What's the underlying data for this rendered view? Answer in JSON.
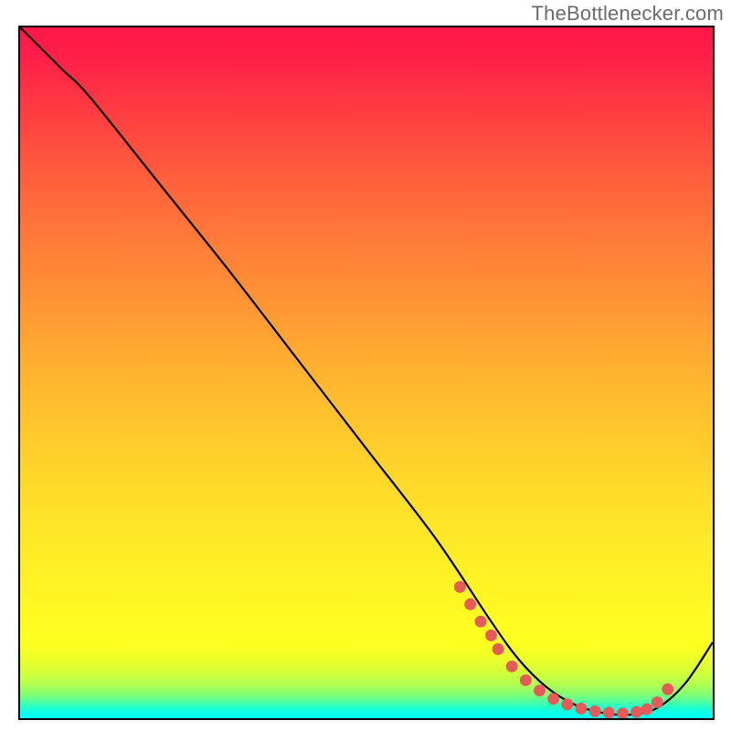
{
  "watermark": "TheBottlenecker.com",
  "chart_data": {
    "type": "line",
    "title": "",
    "xlabel": "",
    "ylabel": "",
    "xlim": [
      0,
      100
    ],
    "ylim": [
      0,
      100
    ],
    "series": [
      {
        "name": "curve",
        "x": [
          0,
          6,
          10,
          20,
          30,
          40,
          50,
          60,
          68,
          72,
          76,
          80,
          84,
          88,
          92,
          96,
          100
        ],
        "y": [
          100,
          94,
          90,
          77.5,
          65,
          52,
          39,
          26,
          14,
          8.5,
          4.5,
          2,
          0.8,
          0.5,
          1.5,
          5,
          11
        ]
      }
    ],
    "markers": {
      "name": "scatter-points",
      "color": "#e65a5a",
      "x": [
        63.5,
        65,
        66.5,
        68,
        69,
        71,
        73,
        75,
        77,
        79,
        81,
        83,
        85,
        87,
        89,
        90.5,
        92,
        93.5
      ],
      "y": [
        19,
        16.5,
        14,
        12,
        10,
        7.5,
        5.5,
        4,
        2.8,
        2,
        1.4,
        1.0,
        0.8,
        0.7,
        0.9,
        1.3,
        2.3,
        4.2
      ]
    },
    "gradient_stops": [
      {
        "pos": 0,
        "color": "#ff1748"
      },
      {
        "pos": 50,
        "color": "#ffb22f"
      },
      {
        "pos": 86,
        "color": "#fffb22"
      },
      {
        "pos": 100,
        "color": "#04fff8"
      }
    ]
  }
}
